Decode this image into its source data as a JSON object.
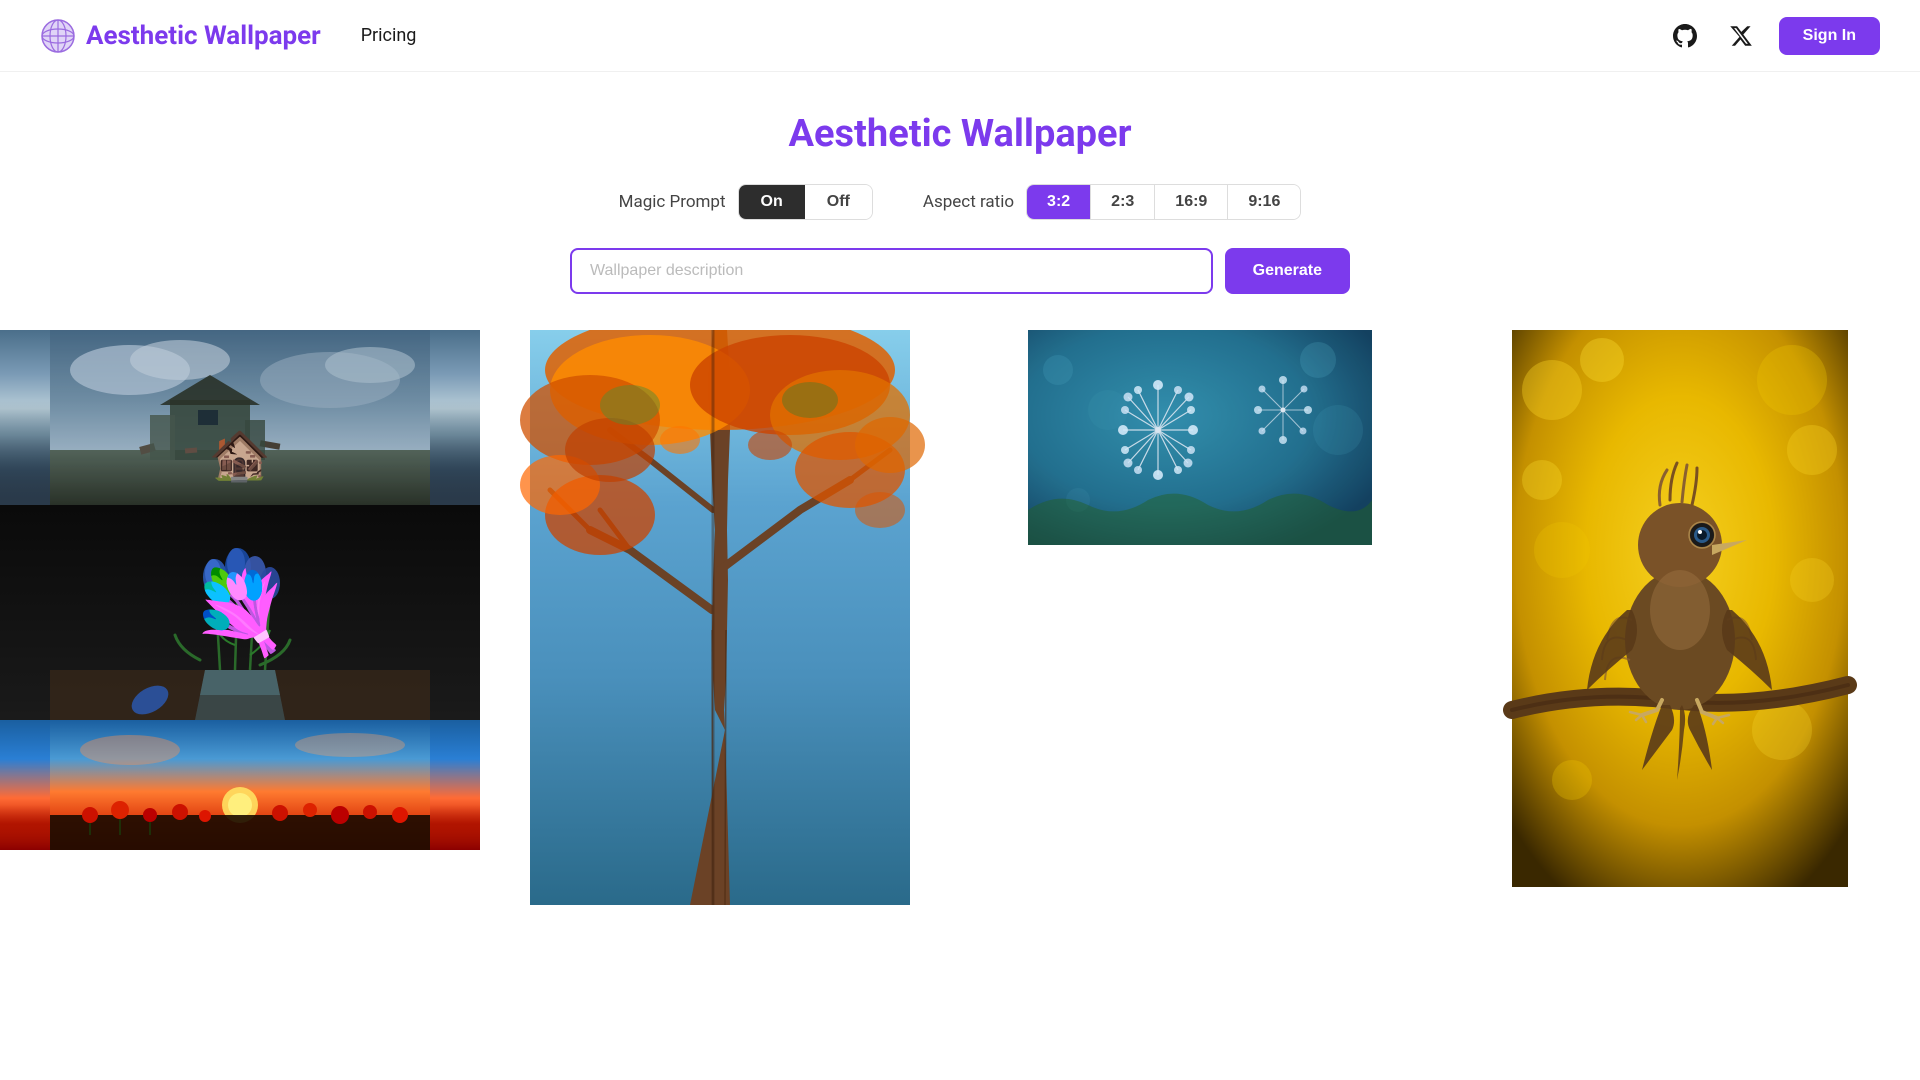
{
  "header": {
    "logo_text": "Aesthetic Wallpaper",
    "logo_icon": "🌐",
    "nav": {
      "pricing_label": "Pricing"
    },
    "sign_in_label": "Sign In"
  },
  "main": {
    "page_title": "Aesthetic Wallpaper",
    "controls": {
      "magic_prompt_label": "Magic Prompt",
      "toggle_on": "On",
      "toggle_off": "Off",
      "aspect_ratio_label": "Aspect ratio",
      "ratios": [
        "3:2",
        "2:3",
        "16:9",
        "9:16"
      ],
      "active_ratio": "3:2",
      "active_toggle": "On"
    },
    "search": {
      "placeholder": "Wallpaper description",
      "generate_label": "Generate"
    }
  },
  "gallery": {
    "columns": [
      {
        "id": "col-1",
        "images": [
          {
            "id": "img-1-1",
            "alt": "Abandoned house in stormy landscape",
            "type": "ruins-storm"
          },
          {
            "id": "img-1-2",
            "alt": "Blue tulips in a glass vase on dark background",
            "type": "blue-tulips"
          },
          {
            "id": "img-1-3",
            "alt": "Sunset over red poppy field",
            "type": "poppy-sunset"
          }
        ]
      },
      {
        "id": "col-2",
        "images": [
          {
            "id": "img-2-1",
            "alt": "Looking up at a tall autumn tree with orange and red leaves",
            "type": "autumn-tree-tall"
          }
        ]
      },
      {
        "id": "col-3",
        "images": [
          {
            "id": "img-3-1",
            "alt": "Dandelion seeds with water droplets macro",
            "type": "dandelion-drops"
          }
        ]
      },
      {
        "id": "col-4",
        "images": [
          {
            "id": "img-4-1",
            "alt": "Brown bird perched on branch with yellow bokeh background",
            "type": "bird-golden"
          }
        ]
      }
    ]
  }
}
